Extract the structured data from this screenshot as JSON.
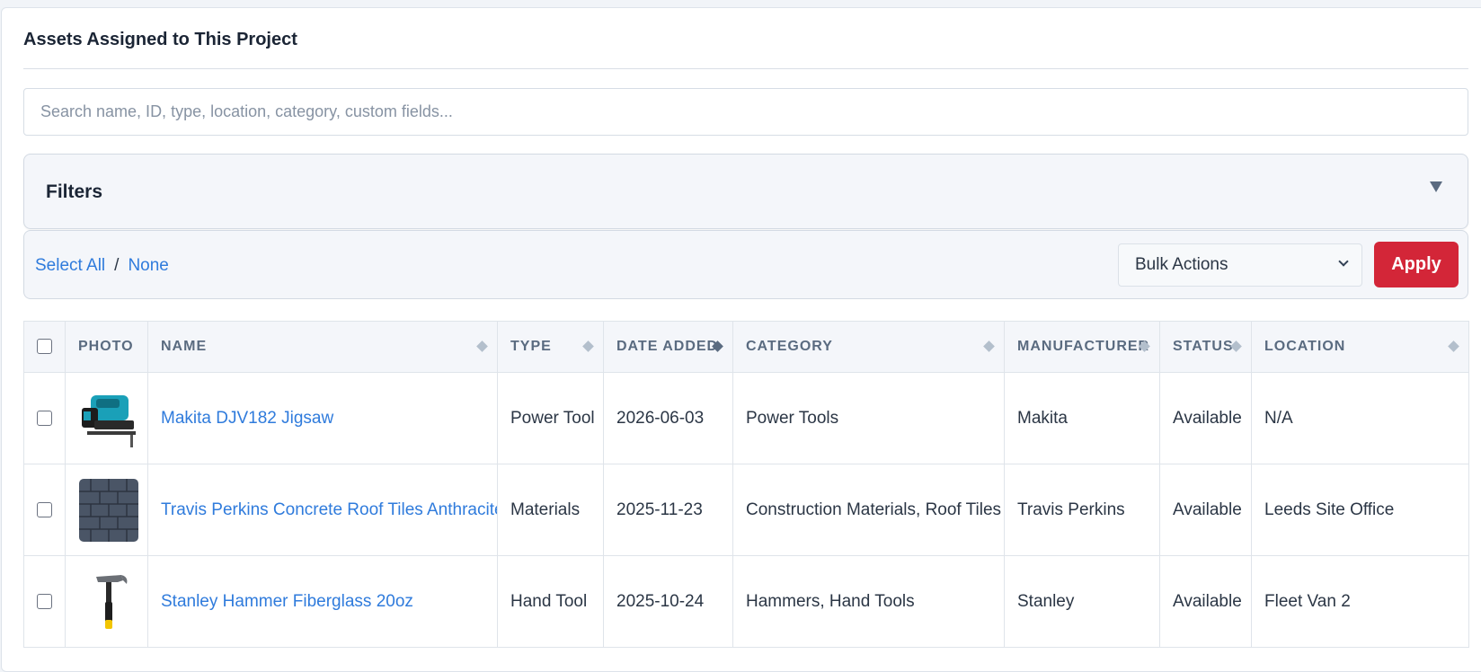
{
  "section": {
    "title": "Assets Assigned to This Project"
  },
  "search": {
    "placeholder": "Search name, ID, type, location, category, custom fields..."
  },
  "filters": {
    "title": "Filters",
    "toggle_icon": "triangle-down-icon"
  },
  "bulk": {
    "select_all": "Select All",
    "separator": "/",
    "select_none": "None",
    "actions_selected": "Bulk Actions",
    "apply_label": "Apply"
  },
  "colors": {
    "link": "#2f7bdc",
    "apply": "#d32638",
    "header_text": "#5a6b80"
  },
  "table": {
    "columns": [
      "Photo",
      "Name",
      "Type",
      "Date Added",
      "Category",
      "Manufacturer",
      "Status",
      "Location"
    ],
    "rows": [
      {
        "photo_icon": "jigsaw-photo",
        "name": "Makita DJV182 Jigsaw",
        "type": "Power Tool",
        "date_added": "2026-06-03",
        "category": "Power Tools",
        "manufacturer": "Makita",
        "status": "Available",
        "location": "N/A"
      },
      {
        "photo_icon": "roof-tiles-photo",
        "name": "Travis Perkins Concrete Roof Tiles Anthracite",
        "type": "Materials",
        "date_added": "2025-11-23",
        "category": "Construction Materials, Roof Tiles",
        "manufacturer": "Travis Perkins",
        "status": "Available",
        "location": "Leeds Site Office"
      },
      {
        "photo_icon": "hammer-photo",
        "name": "Stanley Hammer Fiberglass 20oz",
        "type": "Hand Tool",
        "date_added": "2025-10-24",
        "category": "Hammers, Hand Tools",
        "manufacturer": "Stanley",
        "status": "Available",
        "location": "Fleet Van 2"
      }
    ]
  }
}
